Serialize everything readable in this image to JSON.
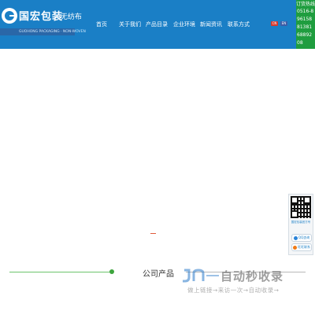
{
  "header": {
    "logo_cn": "国宏包装",
    "logo_cn_sub": "·无纺布",
    "logo_en": "GUOHONG PACKAGING · NON-WOVEN",
    "nav": [
      "首页",
      "关于我们",
      "产品目录",
      "企业环境",
      "新闻资讯",
      "联系方式"
    ],
    "lang_cn": "CN",
    "lang_en": "EN",
    "hotline_label": "订货热线",
    "hotline_number": "0516-89615881381688920​8"
  },
  "float_panel": {
    "qr_caption": "国宏包装官方号",
    "qq_label": "QQ咨询",
    "ww_label": "旺旺联系"
  },
  "section": {
    "title": "公司产品"
  },
  "watermark": {
    "text": "自动秒收录",
    "sub": "做上链接→来访一次→自动收录→"
  },
  "colors": {
    "header_bg": "#1a7fc6",
    "hotline_bg": "#1f9d3f",
    "section_accent": "#3da53d"
  }
}
